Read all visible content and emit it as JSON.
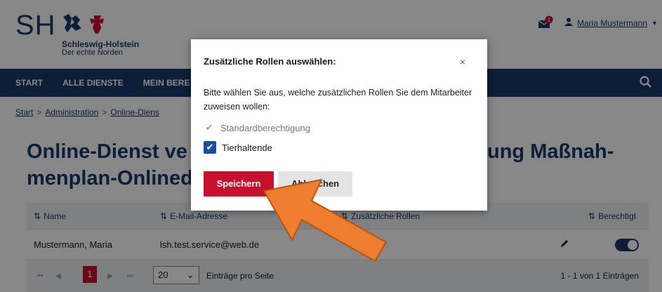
{
  "header": {
    "logo_text": "SH",
    "logo_name": "Schleswig-Holstein",
    "logo_tagline": "Der echte Norden",
    "user_name": "Maria Mustermann",
    "mail_badge": "1"
  },
  "nav": {
    "items": [
      "START",
      "ALLE DIENSTE",
      "MEIN BERE"
    ]
  },
  "breadcrumb": [
    "Start",
    "Administration",
    "Online-Diens"
  ],
  "page": {
    "title_line1_left": "Online-Dienst ve",
    "title_line1_right": "ung Maßnah-",
    "title_line2": "menplan-Onlined"
  },
  "table": {
    "headers": [
      "Name",
      "E-Mail-Adresse",
      "Zusätzliche Rollen",
      "Berechtigt"
    ],
    "rows": [
      {
        "name": "Mustermann, Maria",
        "email": "lsh.test.service@web.de",
        "permitted": true
      }
    ]
  },
  "pager": {
    "current_page": "1",
    "page_size": "20",
    "page_size_label": "Einträge pro Seite",
    "info": "1 - 1 von 1 Einträgen"
  },
  "modal": {
    "title": "Zusätzliche Rollen auswählen:",
    "close": "×",
    "text": "Bitte wählen Sie aus, welche zusätzlichen Rollen Sie dem Mitarbeiter zuweisen wollen:",
    "options": [
      {
        "label": "Standardberechtigung",
        "checked": true,
        "disabled": true
      },
      {
        "label": "Tierhaltende",
        "checked": true,
        "disabled": false
      }
    ],
    "save_label": "Speichern",
    "cancel_label": "Abbrechen"
  },
  "colors": {
    "brand_blue": "#1a3a6b",
    "accent_red": "#c8102e",
    "arrow_orange": "#ee7d30"
  }
}
